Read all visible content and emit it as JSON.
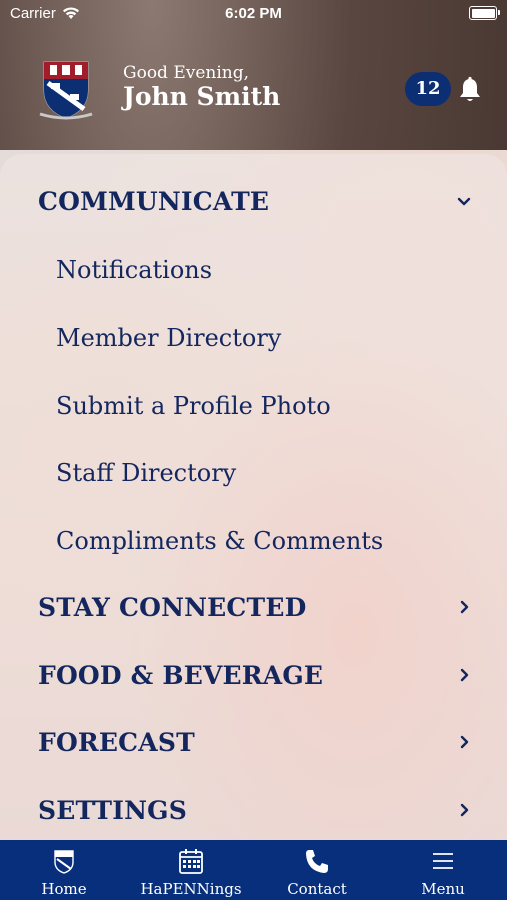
{
  "status_bar": {
    "carrier": "Carrier",
    "time": "6:02 PM"
  },
  "header": {
    "greeting": "Good Evening,",
    "user_name": "John Smith",
    "notification_count": "12"
  },
  "menu": {
    "sections": [
      {
        "label": "COMMUNICATE",
        "expanded": true,
        "items": [
          "Notifications",
          "Member Directory",
          "Submit a Profile Photo",
          "Staff Directory",
          "Compliments & Comments"
        ]
      },
      {
        "label": "STAY CONNECTED",
        "expanded": false
      },
      {
        "label": "FOOD & BEVERAGE",
        "expanded": false
      },
      {
        "label": "FORECAST",
        "expanded": false
      },
      {
        "label": "SETTINGS",
        "expanded": false
      }
    ]
  },
  "tab_bar": {
    "tabs": [
      {
        "label": "Home",
        "icon": "crest-icon"
      },
      {
        "label": "HaPENNings",
        "icon": "calendar-icon"
      },
      {
        "label": "Contact",
        "icon": "phone-icon"
      },
      {
        "label": "Menu",
        "icon": "hamburger-icon"
      }
    ]
  },
  "colors": {
    "navy": "#13265e",
    "tab_bar": "#082f7c",
    "badge": "#0c2e73"
  }
}
